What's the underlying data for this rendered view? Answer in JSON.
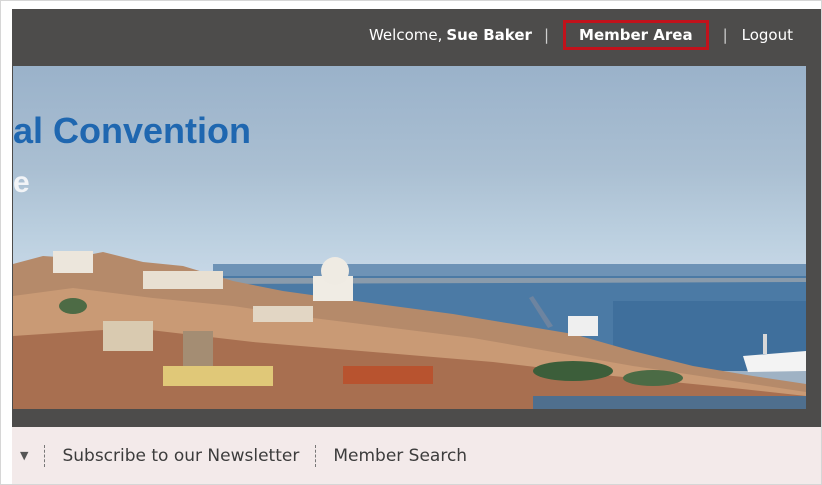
{
  "header": {
    "welcome_prefix": "Welcome, ",
    "user_name": "Sue Baker",
    "member_area_label": "Member Area",
    "separator": "|",
    "logout_label": "Logout"
  },
  "hero": {
    "title": "al Convention",
    "subtitle": "e"
  },
  "nav": {
    "dropdown_icon": "caret-down-icon",
    "items": [
      {
        "label": "Subscribe to our Newsletter"
      },
      {
        "label": "Member Search"
      }
    ]
  },
  "colors": {
    "header_bg": "#4d4c4b",
    "highlight": "#c1121b",
    "title": "#1f67b0",
    "nav_bg": "#f3eaea"
  }
}
